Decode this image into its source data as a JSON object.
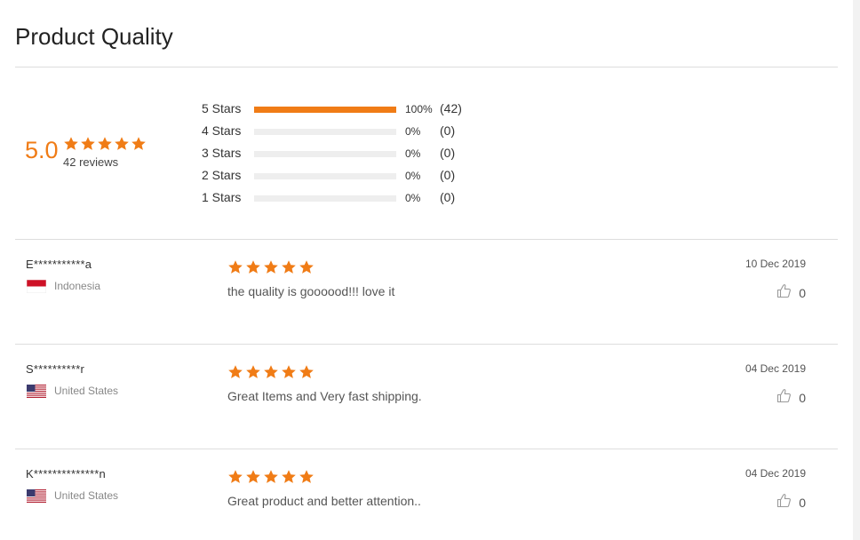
{
  "page": {
    "title": "Product Quality"
  },
  "summary": {
    "score": "5.0",
    "rating": 5,
    "reviews_label": "42 reviews"
  },
  "distribution": [
    {
      "label": "5  Stars",
      "fraction": 1.0,
      "percent": "100%",
      "count": "(42)"
    },
    {
      "label": "4  Stars",
      "fraction": 0.0,
      "percent": "0%",
      "count": "(0)"
    },
    {
      "label": "3  Stars",
      "fraction": 0.0,
      "percent": "0%",
      "count": "(0)"
    },
    {
      "label": "2  Stars",
      "fraction": 0.0,
      "percent": "0%",
      "count": "(0)"
    },
    {
      "label": "1  Stars",
      "fraction": 0.0,
      "percent": "0%",
      "count": "(0)"
    }
  ],
  "reviews": [
    {
      "name": "E***********a",
      "country": "Indonesia",
      "flag": "indonesia-flag",
      "rating": 5,
      "text": "the quality is goooood!!! love it",
      "date": "10 Dec 2019",
      "helpful": "0"
    },
    {
      "name": "S**********r",
      "country": "United States",
      "flag": "us-flag",
      "rating": 5,
      "text": "Great Items and Very fast shipping.",
      "date": "04 Dec 2019",
      "helpful": "0"
    },
    {
      "name": "K**************n",
      "country": "United States",
      "flag": "us-flag",
      "rating": 5,
      "text": "Great product and better attention..",
      "date": "04 Dec 2019",
      "helpful": "0"
    }
  ],
  "icons": {
    "star": "star-icon",
    "helpful": "thumbs-up-icon"
  },
  "colors": {
    "accent": "#f07c16",
    "bar_track": "#eeeeee",
    "divider": "#dddddd"
  }
}
